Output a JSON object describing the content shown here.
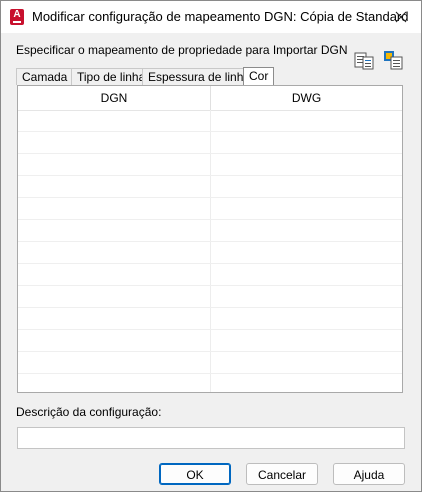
{
  "window": {
    "title": "Modificar configuração de mapeamento DGN: Cópia de Standard",
    "close_glyph": "✕"
  },
  "app_icon": {
    "letter": "A"
  },
  "mapping_label": "Especificar o mapeamento de propriedade para Importar DGN",
  "toolbar": {
    "icons": [
      "import-dgn-properties-icon",
      "export-dwg-properties-icon"
    ]
  },
  "tabs": [
    {
      "label": "Camada",
      "active": false
    },
    {
      "label": "Tipo de linha",
      "active": false
    },
    {
      "label": "Espessura de linha",
      "active": false
    },
    {
      "label": "Cor",
      "active": true
    }
  ],
  "grid": {
    "columns": [
      "DGN",
      "DWG"
    ],
    "rows": [
      [
        "",
        ""
      ],
      [
        "",
        ""
      ],
      [
        "",
        ""
      ],
      [
        "",
        ""
      ],
      [
        "",
        ""
      ],
      [
        "",
        ""
      ],
      [
        "",
        ""
      ],
      [
        "",
        ""
      ],
      [
        "",
        ""
      ],
      [
        "",
        ""
      ],
      [
        "",
        ""
      ],
      [
        "",
        ""
      ],
      [
        "",
        ""
      ]
    ]
  },
  "description": {
    "label": "Descrição da configuração:",
    "value": ""
  },
  "buttons": {
    "ok": "OK",
    "cancel": "Cancelar",
    "help": "Ajuda"
  },
  "colors": {
    "accent": "#0067c0",
    "app_red": "#c8102e"
  }
}
